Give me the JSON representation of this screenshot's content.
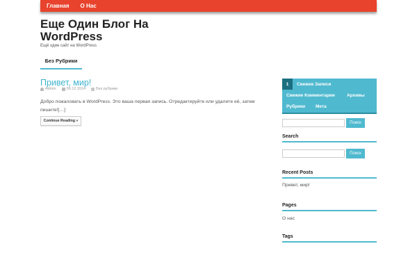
{
  "topnav": {
    "home": "Главная",
    "about": "О Нас"
  },
  "site": {
    "title": "Еще Один Блог На WordPress",
    "tagline": "Ещё один сайт на WordPress"
  },
  "category_nav": {
    "item": "Без Рубрики"
  },
  "post": {
    "title": "Привет, мир!",
    "author": "Admin",
    "date": "09.12.2014",
    "category": "Без рубрики",
    "excerpt": "Добро пожаловать в WordPress. Это ваша первая запись. Отредактируйте или удалите её, затем пишите![…]",
    "continue_label": "Continue Reading »"
  },
  "sidebar": {
    "tabs": {
      "active_number": "1",
      "recent_posts": "Свежие Записи",
      "recent_comments": "Свежие Комментарии",
      "archives": "Архивы",
      "categories": "Рубрики",
      "meta": "Мета"
    },
    "search_button": "Поиск",
    "search_widget_title": "Search",
    "recent_posts_title": "Recent Posts",
    "recent_post_1": "Привет, мир!",
    "pages_title": "Pages",
    "page_1": "О нас",
    "tags_title": "Tags"
  },
  "colors": {
    "accent": "#4fb9cf",
    "nav": "#e8432d"
  }
}
